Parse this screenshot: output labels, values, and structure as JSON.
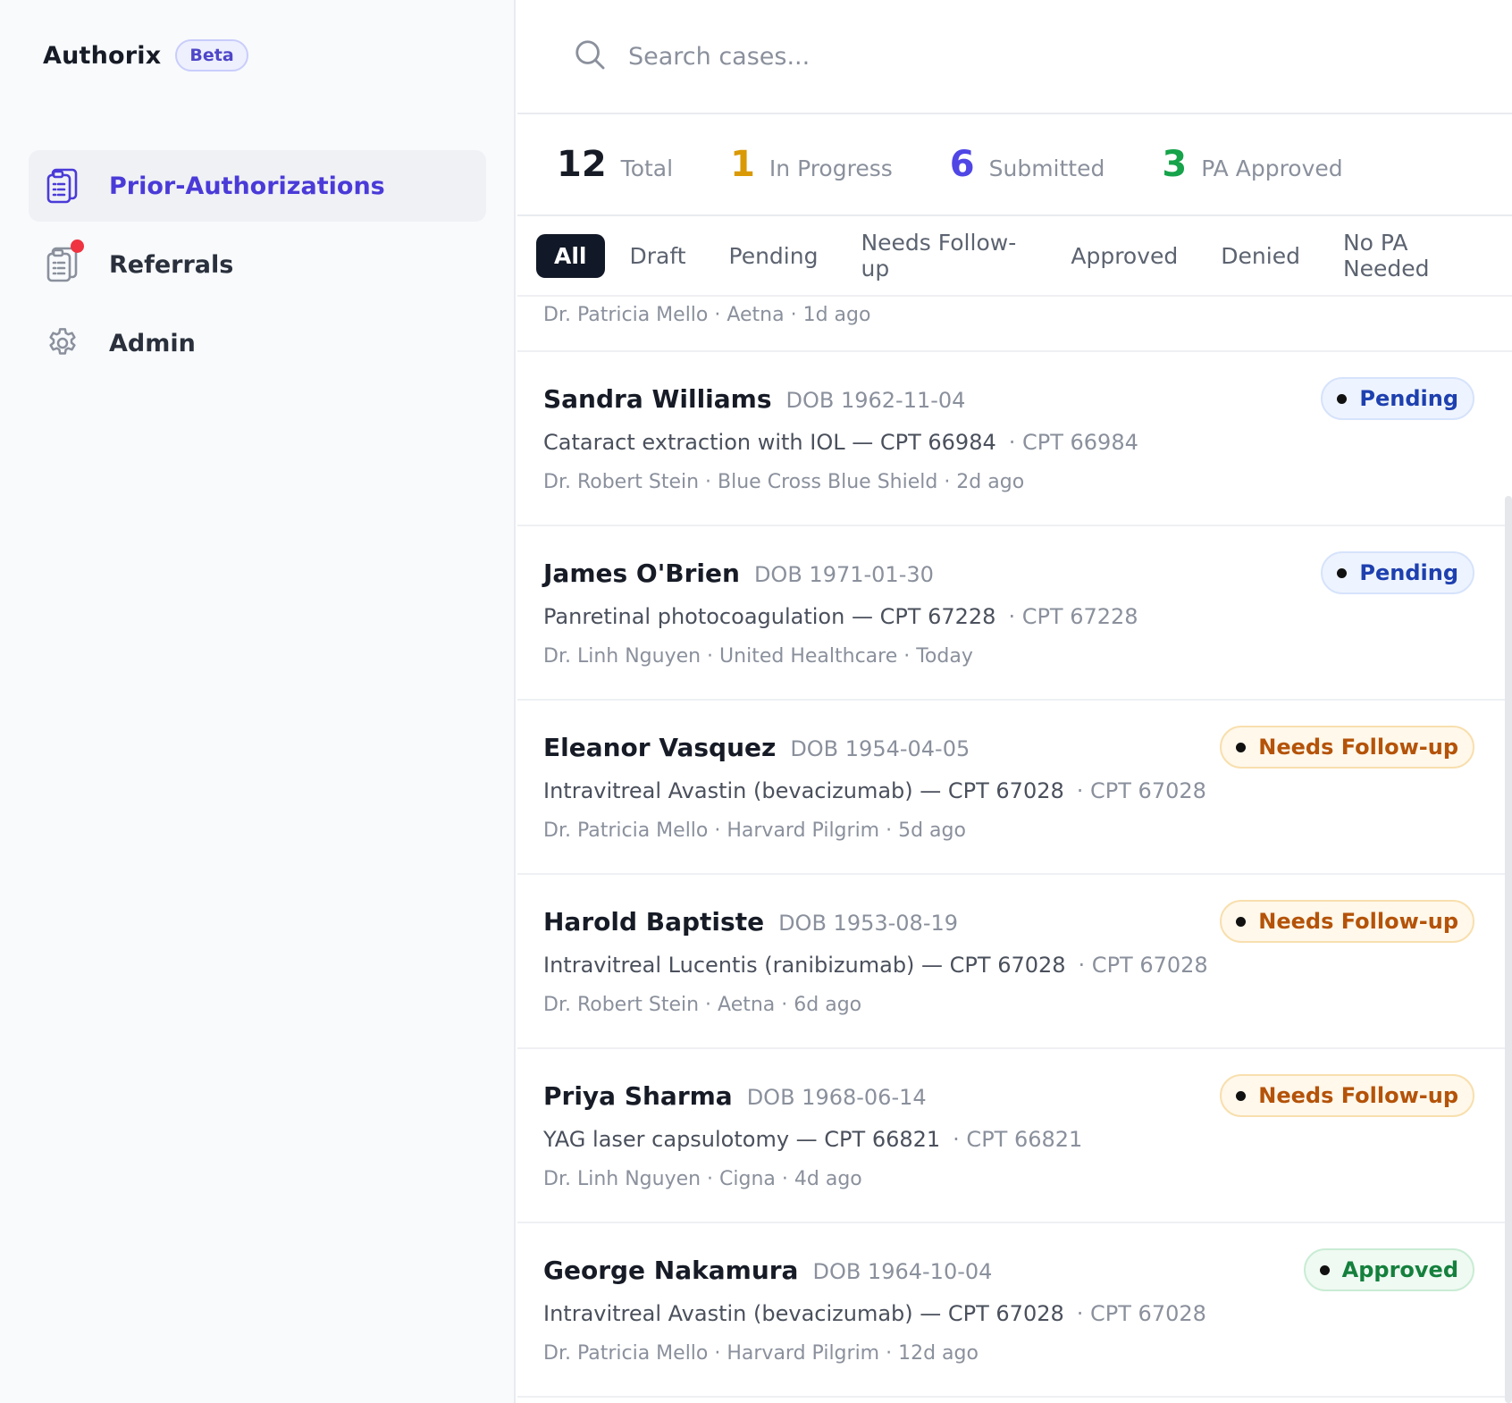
{
  "brand": {
    "name": "Authorix",
    "badge": "Beta"
  },
  "nav": {
    "items": [
      {
        "label": "Prior-Authorizations",
        "icon": "clipboard-icon",
        "active": true
      },
      {
        "label": "Referrals",
        "icon": "clipboard-stack-icon",
        "active": false
      },
      {
        "label": "Admin",
        "icon": "gear-icon",
        "active": false
      }
    ]
  },
  "search": {
    "placeholder": "Search cases..."
  },
  "stats": [
    {
      "num": "12",
      "label": "Total",
      "color": "#161b26"
    },
    {
      "num": "1",
      "label": "In Progress",
      "color": "#d99a06"
    },
    {
      "num": "6",
      "label": "Submitted",
      "color": "#4f46e5"
    },
    {
      "num": "3",
      "label": "PA Approved",
      "color": "#16a34a"
    }
  ],
  "tabs": [
    "All",
    "Draft",
    "Pending",
    "Needs Follow-up",
    "Approved",
    "Denied",
    "No PA Needed"
  ],
  "partial_row": {
    "meta": "Dr. Patricia Mello · Aetna · 1d ago"
  },
  "rows": [
    {
      "name": "Sandra Williams",
      "dob": "DOB 1962-11-04",
      "procedure": "Cataract extraction with IOL — CPT 66984",
      "cpt": "· CPT 66984",
      "meta": "Dr. Robert Stein · Blue Cross Blue Shield · 2d ago",
      "status": "Pending"
    },
    {
      "name": "James O'Brien",
      "dob": "DOB 1971-01-30",
      "procedure": "Panretinal photocoagulation — CPT 67228",
      "cpt": "· CPT 67228",
      "meta": "Dr. Linh Nguyen · United Healthcare · Today",
      "status": "Pending"
    },
    {
      "name": "Eleanor Vasquez",
      "dob": "DOB 1954-04-05",
      "procedure": "Intravitreal Avastin (bevacizumab) — CPT 67028",
      "cpt": "· CPT 67028",
      "meta": "Dr. Patricia Mello · Harvard Pilgrim · 5d ago",
      "status": "Needs Follow-up"
    },
    {
      "name": "Harold Baptiste",
      "dob": "DOB 1953-08-19",
      "procedure": "Intravitreal Lucentis (ranibizumab) — CPT 67028",
      "cpt": "· CPT 67028",
      "meta": "Dr. Robert Stein · Aetna · 6d ago",
      "status": "Needs Follow-up"
    },
    {
      "name": "Priya Sharma",
      "dob": "DOB 1968-06-14",
      "procedure": "YAG laser capsulotomy — CPT 66821",
      "cpt": "· CPT 66821",
      "meta": "Dr. Linh Nguyen · Cigna · 4d ago",
      "status": "Needs Follow-up"
    },
    {
      "name": "George Nakamura",
      "dob": "DOB 1964-10-04",
      "procedure": "Intravitreal Avastin (bevacizumab) — CPT 67028",
      "cpt": "· CPT 67028",
      "meta": "Dr. Patricia Mello · Harvard Pilgrim · 12d ago",
      "status": "Approved"
    }
  ]
}
